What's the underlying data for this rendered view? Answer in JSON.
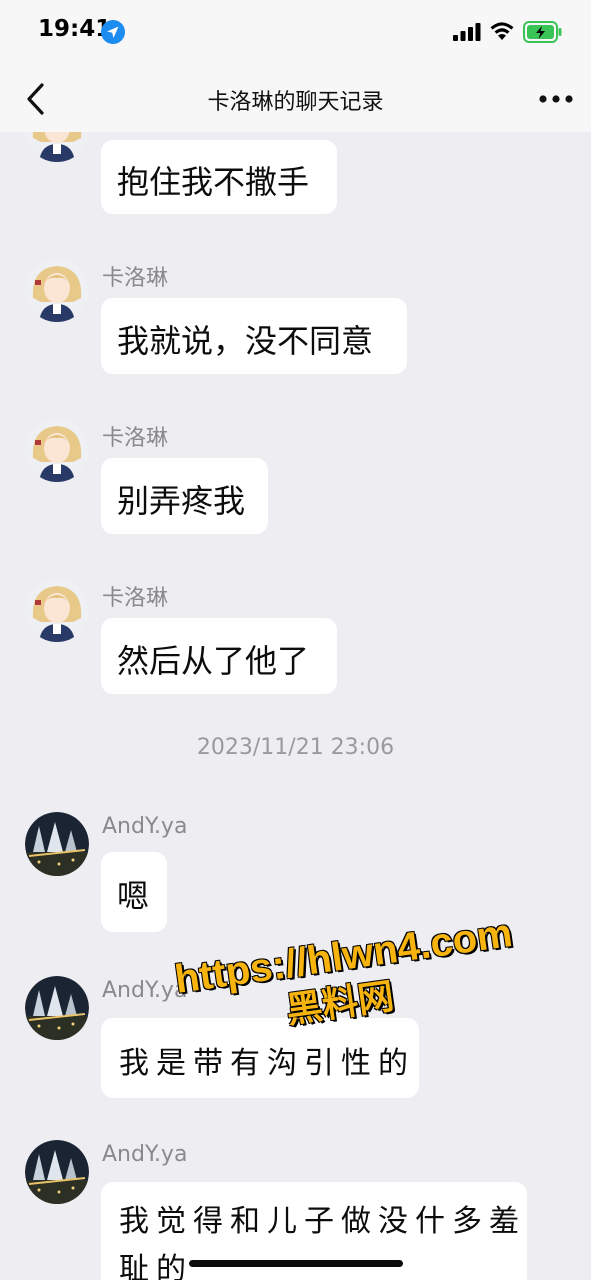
{
  "status_bar": {
    "time": "19:41",
    "icons": [
      "location-arrow-icon",
      "cellular-signal-icon",
      "wifi-icon",
      "battery-charging-icon"
    ],
    "accent_color": "#1d8cf0",
    "battery_color": "#3bc456"
  },
  "nav": {
    "title": "卡洛琳的聊天记录",
    "back_icon": "chevron-left-icon",
    "more_icon": "ellipsis-icon"
  },
  "messages": [
    {
      "sender": "",
      "text": "抱住我不撒手",
      "style": "typed"
    },
    {
      "sender": "卡洛琳",
      "text": "我就说，没不同意",
      "style": "typed"
    },
    {
      "sender": "卡洛琳",
      "text": "别弄疼我",
      "style": "typed"
    },
    {
      "sender": "卡洛琳",
      "text": "然后从了他了",
      "style": "typed"
    },
    {
      "sender": "AndY.ya",
      "text": "嗯",
      "style": "typed"
    },
    {
      "sender": "AndY.ya",
      "text": "我是带有沟引性的",
      "style": "handwritten"
    },
    {
      "sender": "AndY.ya",
      "text_line1": "我觉得和儿子做没什多羞",
      "text_line2": "耻的",
      "style": "handwritten"
    }
  ],
  "timestamp": "2023/11/21 23:06",
  "watermark": {
    "line1": "https://hlwn4.com",
    "line2": "黑料网",
    "color": "#f7b30e"
  }
}
